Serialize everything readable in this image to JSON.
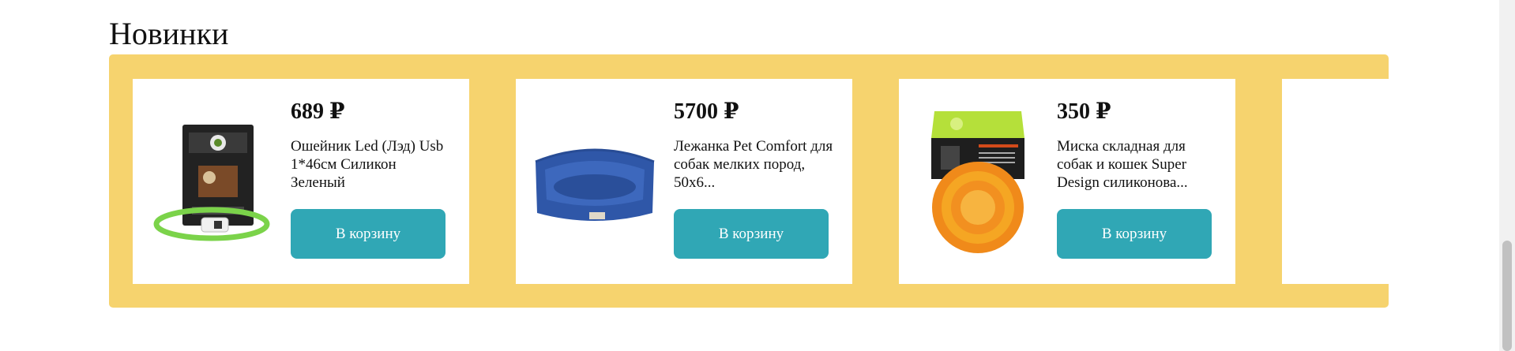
{
  "section": {
    "title": "Новинки"
  },
  "products": [
    {
      "price": "689 ₽",
      "name": "Ошейник Led (Лэд) Usb 1*46см Силикон Зеленый",
      "button_label": "В корзину",
      "image_icon": "led-collar-image"
    },
    {
      "price": "5700 ₽",
      "name": "Лежанка Pet Comfort для собак мелких пород, 50х6...",
      "button_label": "В корзину",
      "image_icon": "dog-bed-image"
    },
    {
      "price": "350 ₽",
      "name": "Миска складная для собак и кошек Super Design силиконова...",
      "button_label": "В корзину",
      "image_icon": "folding-bowl-image"
    }
  ],
  "colors": {
    "carousel_background": "#f6d36e",
    "button_background": "#30a7b5",
    "button_text": "#ffffff",
    "card_background": "#ffffff"
  }
}
